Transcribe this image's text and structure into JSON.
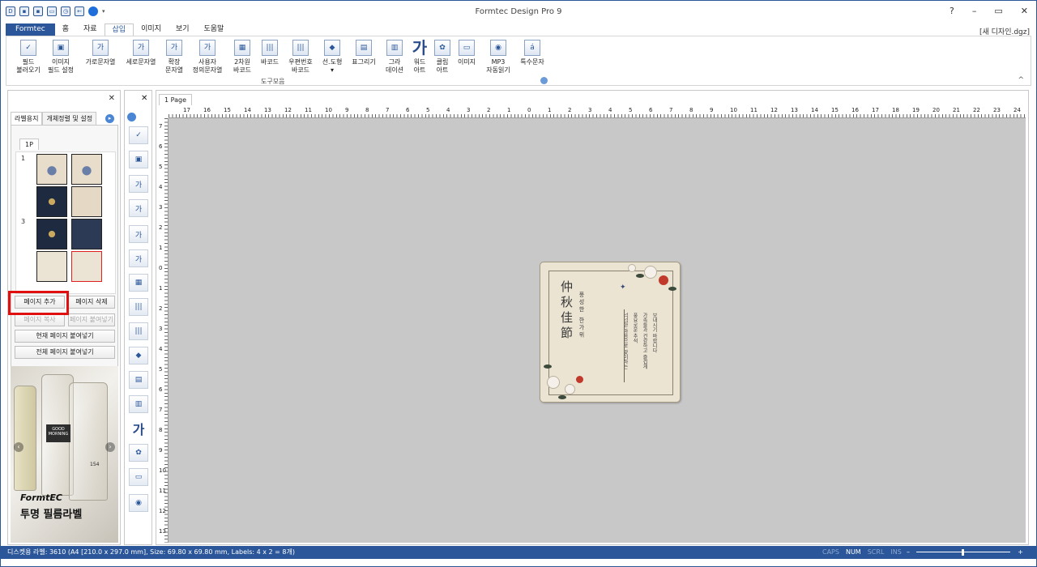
{
  "app": {
    "title": "Formtec Design Pro 9",
    "doc_name": "[새 디자인.dgz]"
  },
  "window_controls": {
    "help": "?",
    "minimize": "–",
    "restore": "▭",
    "close": "✕"
  },
  "ribbon_tabs": [
    "Formtec",
    "홈",
    "자료",
    "삽입",
    "이미지",
    "보기",
    "도움말"
  ],
  "ribbon": {
    "buttons": [
      {
        "l1": "필드",
        "l2": "불러오기",
        "icon": "✓"
      },
      {
        "l1": "이미지",
        "l2": "필드 설정",
        "icon": "▣"
      },
      {
        "l1": "가로문자열",
        "l2": "",
        "icon": "가"
      },
      {
        "l1": "세로문자열",
        "l2": "",
        "icon": "가"
      },
      {
        "l1": "확장",
        "l2": "문자열",
        "icon": "가"
      },
      {
        "l1": "사용자",
        "l2": "정의문자열",
        "icon": "가"
      },
      {
        "l1": "2차원",
        "l2": "바코드",
        "icon": "▦"
      },
      {
        "l1": "바코드",
        "l2": "",
        "icon": "|||"
      },
      {
        "l1": "우편번호",
        "l2": "바코드",
        "icon": "|||"
      },
      {
        "l1": "선.도형",
        "l2": "▾",
        "icon": "◆"
      },
      {
        "l1": "표그리기",
        "l2": "",
        "icon": "▤"
      },
      {
        "l1": "그라",
        "l2": "데이션",
        "icon": "▥"
      },
      {
        "l1": "워드",
        "l2": "아트",
        "icon": "가"
      },
      {
        "l1": "클립",
        "l2": "아트",
        "icon": "✿"
      },
      {
        "l1": "이미지",
        "l2": "",
        "icon": "▭"
      },
      {
        "l1": "MP3",
        "l2": "자동읽기",
        "icon": "◉"
      },
      {
        "l1": "특수문자",
        "l2": "",
        "icon": "á"
      }
    ],
    "group_label": "도구모음"
  },
  "left_panel": {
    "tabs": [
      "라벨용지",
      "개체정렬 및 설정"
    ],
    "page_tab": "1P",
    "row_numbers": [
      "1",
      "3"
    ],
    "buttons": {
      "add_page": "페이지 추가",
      "delete_page": "페이지 삭제",
      "copy_page": "페이지 복사",
      "paste_page": "페이지 붙여넣기",
      "paste_current": "현재 페이지 붙여넣기",
      "paste_all": "전체 페이지 붙여넣기"
    },
    "ad": {
      "bottle_text1": "GOOD",
      "bottle_text2": "MORNING",
      "bottle_num": "154",
      "brand": "FormtEC",
      "caption": "투명 필름라벨"
    }
  },
  "document": {
    "tab": "1 Page",
    "h_ruler": [
      "17",
      "16",
      "15",
      "14",
      "13",
      "12",
      "11",
      "10",
      "9",
      "8",
      "7",
      "6",
      "5",
      "4",
      "3",
      "2",
      "1",
      "0",
      "1",
      "2",
      "3",
      "4",
      "5",
      "6",
      "7",
      "8",
      "9",
      "10",
      "11",
      "12",
      "13",
      "14",
      "15",
      "16",
      "17",
      "18",
      "19",
      "20",
      "21",
      "22",
      "23",
      "24"
    ],
    "v_ruler": [
      "7",
      "6",
      "5",
      "4",
      "3",
      "2",
      "1",
      "0",
      "1",
      "2",
      "3",
      "4",
      "5",
      "6",
      "7",
      "8",
      "9",
      "10",
      "11",
      "12",
      "13"
    ]
  },
  "label_card": {
    "title": "仲秋佳節",
    "subtitle": "풍성한 한가위",
    "col1": "보내시기 바랍니다",
    "col2": "가족들과 건강하고 즐겁게",
    "col3": "풍요로운 추석",
    "col4": "넉넉한 마음으로 맞이하는"
  },
  "status": {
    "text": "디스켓용 라벨: 3610 (A4 [210.0 x 297.0 mm], Size: 69.80 x 69.80 mm,  Labels: 4 x 2 = 8개)",
    "keys": [
      {
        "label": "CAPS",
        "on": false
      },
      {
        "label": "NUM",
        "on": true
      },
      {
        "label": "SCRL",
        "on": false
      },
      {
        "label": "INS",
        "on": false
      }
    ],
    "zoom_minus": "–",
    "zoom_plus": "+"
  }
}
